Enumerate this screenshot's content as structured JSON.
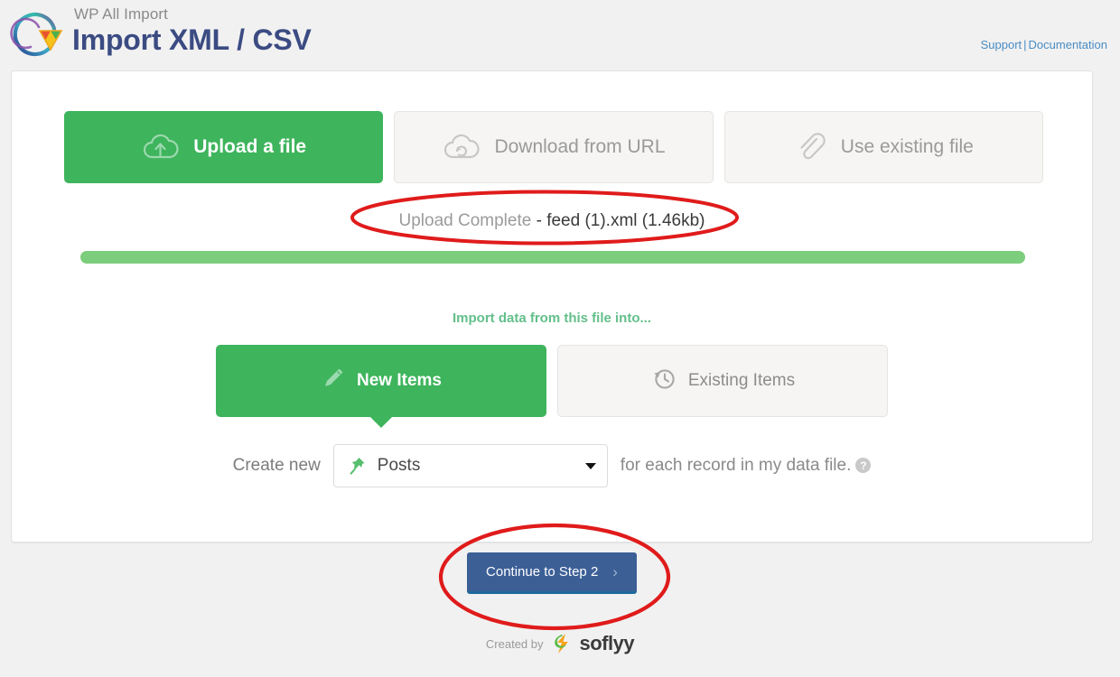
{
  "header": {
    "brand_sub": "WP All Import",
    "title": "Import XML / CSV",
    "support_link": "Support",
    "separator": "|",
    "documentation_link": "Documentation",
    "logo_icon": "wp-all-import-logo-icon"
  },
  "source_tabs": [
    {
      "label": "Upload a file",
      "icon": "cloud-upload-icon",
      "active": true
    },
    {
      "label": "Download from URL",
      "icon": "cloud-refresh-icon",
      "active": false
    },
    {
      "label": "Use existing file",
      "icon": "paperclip-icon",
      "active": false
    }
  ],
  "upload": {
    "status_label": "Upload Complete",
    "file_info": "- feed (1).xml (1.46kb)",
    "progress_percent": 100,
    "progress_color": "#7ccd7c"
  },
  "import_into": {
    "heading": "Import data from this file into...",
    "tabs": [
      {
        "label": "New Items",
        "icon": "pencil-icon",
        "active": true
      },
      {
        "label": "Existing Items",
        "icon": "clock-history-icon",
        "active": false
      }
    ]
  },
  "create_row": {
    "prefix": "Create new",
    "selected_option": "Posts",
    "select_icon": "pushpin-icon",
    "suffix": "for each record in my data file.",
    "help_icon": "?"
  },
  "continue": {
    "label": "Continue to Step 2",
    "chevron": "›",
    "color": "#3c5f96"
  },
  "footer": {
    "created_by": "Created by",
    "brand": "soflyy",
    "brand_icon": "soflyy-logo-icon"
  },
  "annotations": {
    "accent_color": "#e01b1b",
    "ellipse_upload": "ellipse-around-upload-complete",
    "ellipse_continue": "ellipse-around-continue-button"
  }
}
